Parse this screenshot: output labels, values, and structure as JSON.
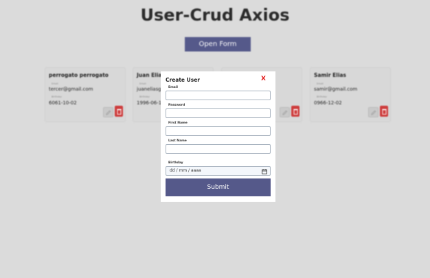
{
  "page": {
    "title": "User-Crud Axios",
    "open_form_label": "Open Form"
  },
  "users": [
    {
      "name": "perrogato perrogato",
      "email_label": "Email",
      "email": "tercer@gmail.com",
      "birthday_label": "Birthday",
      "birthday": "6061-10-02"
    },
    {
      "name": "Juan Elias",
      "email_label": "Email",
      "email": "juaneliasga",
      "birthday_label": "Birthday",
      "birthday": "1996-06-1"
    },
    {
      "name": "",
      "email_label": "",
      "email": "",
      "birthday_label": "",
      "birthday": ""
    },
    {
      "name": "Samir Elias",
      "email_label": "Email",
      "email": "samir@gmail.com",
      "birthday_label": "Birthday",
      "birthday": "0966-12-02"
    }
  ],
  "modal": {
    "title": "Create User",
    "close_label": "X",
    "email_label": "Email",
    "password_label": "Password",
    "first_name_label": "First Name",
    "last_name_label": "Last Name",
    "birthday_label": "Birthday",
    "birthday_value": "dd / mm / aaaa",
    "submit_label": "Submit"
  },
  "colors": {
    "accent": "#55598a",
    "delete": "#cd3b3b",
    "close": "#e21a1a",
    "background": "#dbdbdb"
  },
  "icons": {
    "edit": "pencil-icon",
    "delete": "trash-icon",
    "calendar": "calendar-icon"
  }
}
